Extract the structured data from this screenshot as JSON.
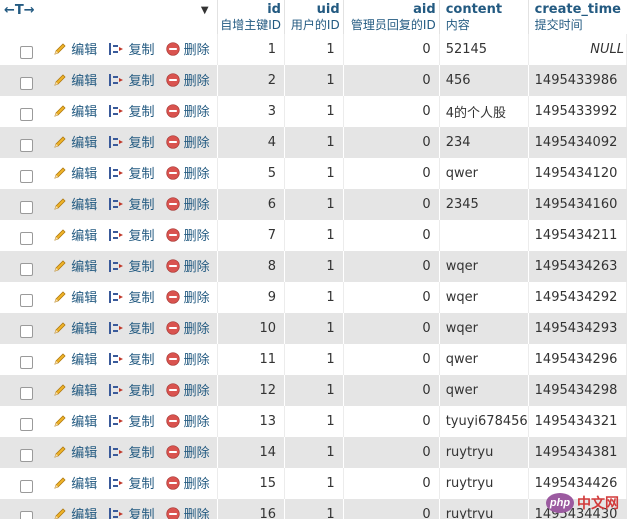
{
  "header": {
    "arrows": "←T→",
    "columns": [
      {
        "key": "id",
        "name": "id",
        "comment": "自增主键ID",
        "align": "num"
      },
      {
        "key": "uid",
        "name": "uid",
        "comment": "用户的ID",
        "align": "num"
      },
      {
        "key": "aid",
        "name": "aid",
        "comment": "管理员回复的ID",
        "align": "num"
      },
      {
        "key": "content",
        "name": "content",
        "comment": "内容",
        "align": "txt"
      },
      {
        "key": "create_time",
        "name": "create_time",
        "comment": "提交时间",
        "align": "txt"
      }
    ]
  },
  "actions": {
    "edit": "编辑",
    "copy": "复制",
    "delete": "删除"
  },
  "rows": [
    {
      "id": "1",
      "uid": "1",
      "aid": "0",
      "content": "52145",
      "create_time": "NULL"
    },
    {
      "id": "2",
      "uid": "1",
      "aid": "0",
      "content": "456",
      "create_time": "1495433986"
    },
    {
      "id": "3",
      "uid": "1",
      "aid": "0",
      "content": "4的个人股",
      "create_time": "1495433992"
    },
    {
      "id": "4",
      "uid": "1",
      "aid": "0",
      "content": "234",
      "create_time": "1495434092"
    },
    {
      "id": "5",
      "uid": "1",
      "aid": "0",
      "content": "qwer",
      "create_time": "1495434120"
    },
    {
      "id": "6",
      "uid": "1",
      "aid": "0",
      "content": "2345",
      "create_time": "1495434160"
    },
    {
      "id": "7",
      "uid": "1",
      "aid": "0",
      "content": "",
      "create_time": "1495434211"
    },
    {
      "id": "8",
      "uid": "1",
      "aid": "0",
      "content": "wqer",
      "create_time": "1495434263"
    },
    {
      "id": "9",
      "uid": "1",
      "aid": "0",
      "content": "wqer",
      "create_time": "1495434292"
    },
    {
      "id": "10",
      "uid": "1",
      "aid": "0",
      "content": "wqer",
      "create_time": "1495434293"
    },
    {
      "id": "11",
      "uid": "1",
      "aid": "0",
      "content": "qwer",
      "create_time": "1495434296"
    },
    {
      "id": "12",
      "uid": "1",
      "aid": "0",
      "content": "qwer",
      "create_time": "1495434298"
    },
    {
      "id": "13",
      "uid": "1",
      "aid": "0",
      "content": "tyuyi678456",
      "create_time": "1495434321"
    },
    {
      "id": "14",
      "uid": "1",
      "aid": "0",
      "content": "ruytryu",
      "create_time": "1495434381"
    },
    {
      "id": "15",
      "uid": "1",
      "aid": "0",
      "content": "ruytryu",
      "create_time": "1495434426"
    },
    {
      "id": "16",
      "uid": "1",
      "aid": "0",
      "content": "ruytryu",
      "create_time": "1495434430"
    }
  ],
  "watermark": {
    "badge": "php",
    "site": "中文网"
  },
  "colors": {
    "link": "#235a81",
    "even_row": "#e5e5e5",
    "delete_icon": "#d9534f",
    "pencil": "#e8a21a"
  }
}
